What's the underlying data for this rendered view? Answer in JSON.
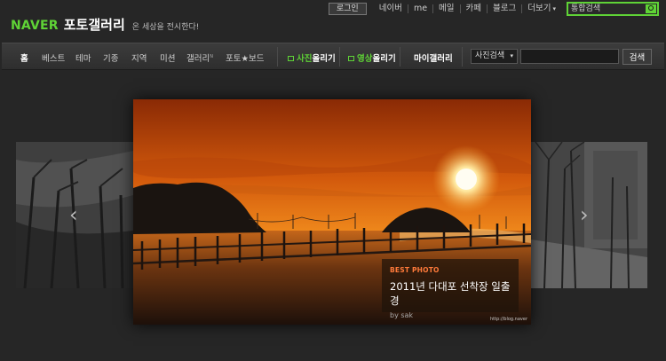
{
  "header": {
    "logo_brand": "NAVER",
    "logo_title": "포토갤러리",
    "tagline": "온 세상을 전시한다!"
  },
  "util": {
    "login": "로그인",
    "links": [
      "네이버",
      "me",
      "메일",
      "카페",
      "블로그"
    ],
    "more": "더보기",
    "search_placeholder": "통합검색"
  },
  "nav": {
    "items": [
      "홈",
      "베스트",
      "테마",
      "기종",
      "지역",
      "미션",
      "갤러리",
      "포토★보드"
    ],
    "gallery_badge": "N",
    "photo_upload": "사진",
    "photo_upload_rest": "올리기",
    "video_upload": "영상",
    "video_upload_rest": "올리기",
    "my_gallery": "마이갤러리",
    "search_select": "사진검색",
    "search_button": "검색"
  },
  "feature": {
    "label": "BEST PHOTO",
    "title": "2011년 다대포 선착장 일출경",
    "by": "by sak",
    "credit": "http://blog.naver"
  },
  "colors": {
    "brand_green": "#5fd336",
    "accent_orange": "#ff7a3a",
    "background": "#262626"
  }
}
